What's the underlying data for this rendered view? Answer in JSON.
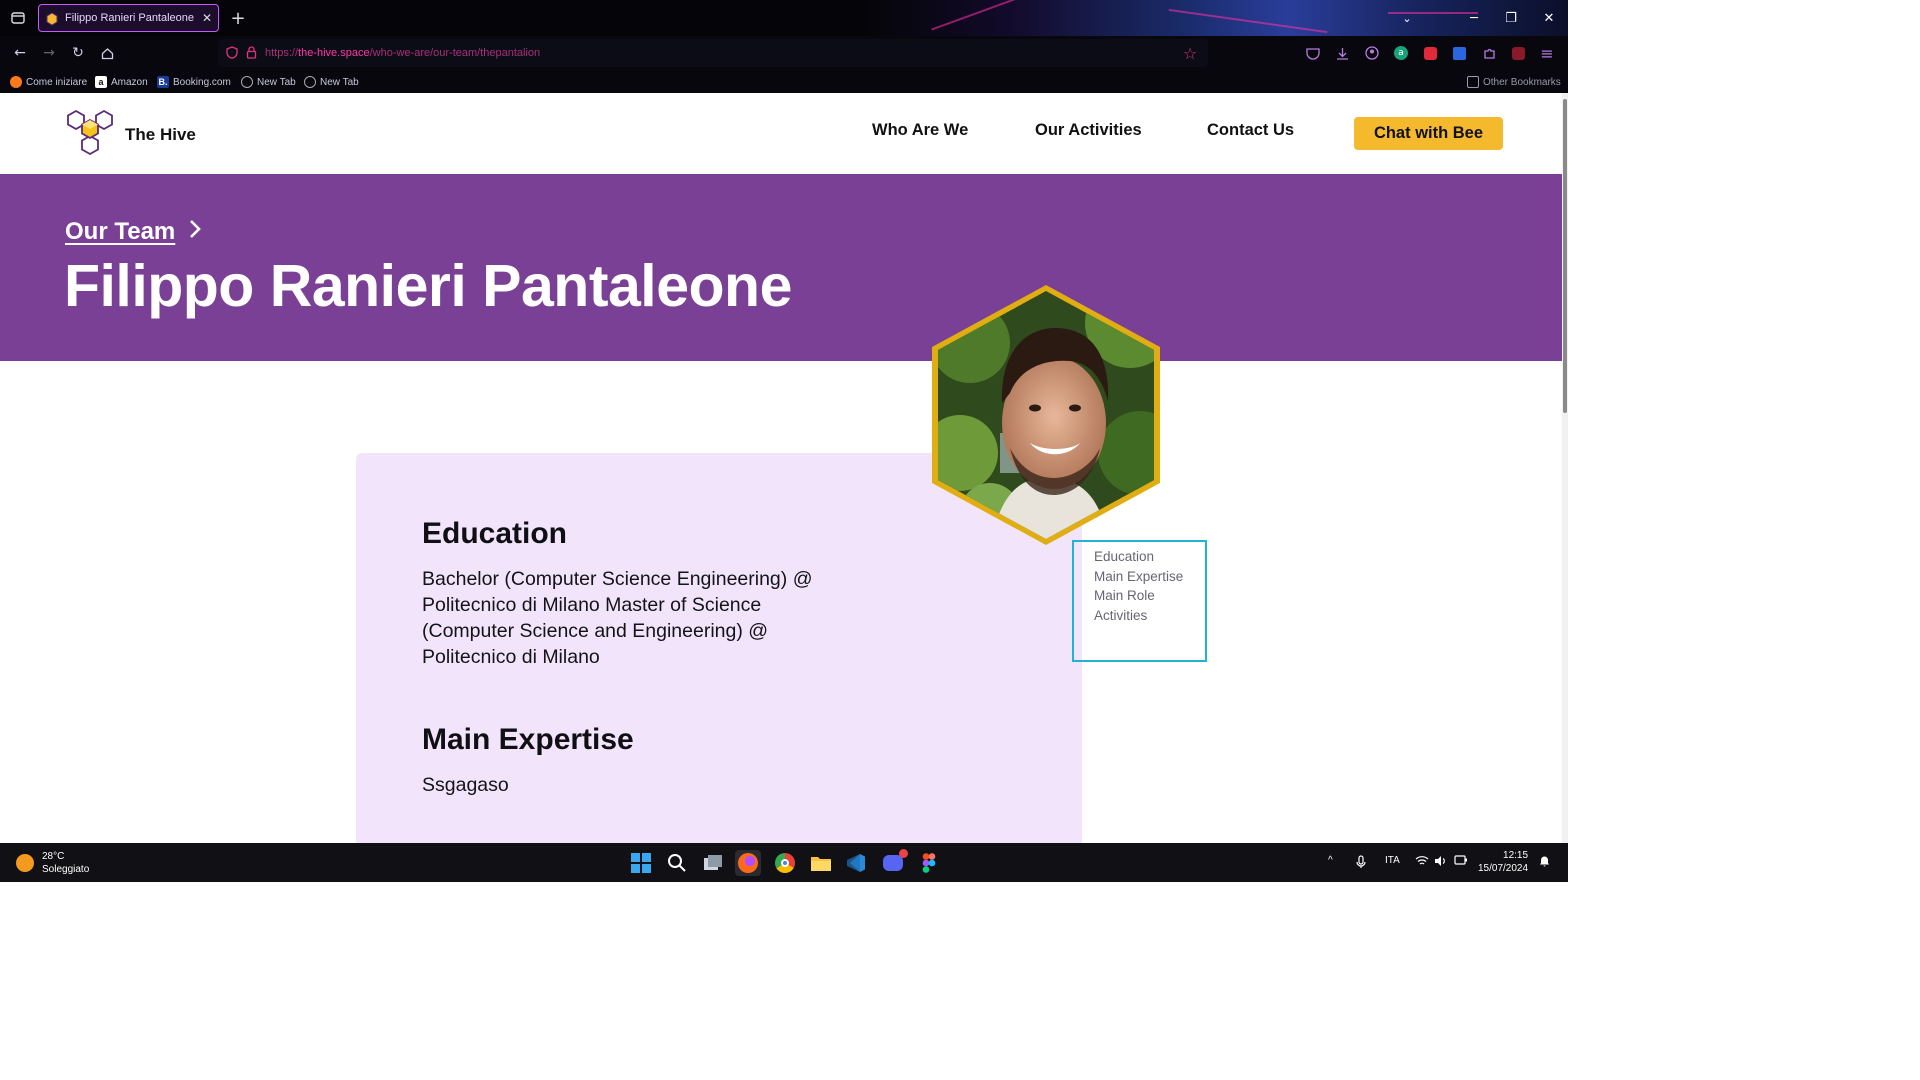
{
  "browser": {
    "tab_title": "Filippo Ranieri Pantaleone | Team",
    "url_prefix": "https://",
    "url_domain": "the-hive.space",
    "url_path": "/who-we-are/our-team/thepantalion",
    "bookmarks": [
      "Come iniziare",
      "Amazon",
      "Booking.com",
      "New Tab",
      "New Tab"
    ],
    "other_bookmarks": "Other Bookmarks",
    "win_controls": {
      "min": "─",
      "max": "❐",
      "close": "✕"
    }
  },
  "site": {
    "name": "The Hive",
    "nav": [
      "Who Are We",
      "Our Activities",
      "Contact Us"
    ],
    "cta": "Chat with Bee",
    "accent_purple": "#7a4095",
    "accent_yellow": "#f5b92e"
  },
  "hero": {
    "breadcrumb": "Our Team",
    "person_name": "Filippo Ranieri Pantaleone"
  },
  "profile": {
    "education_title": "Education",
    "education_body": "Bachelor (Computer Science Engineering) @ Politecnico di Milano Master of Science (Computer Science and Engineering) @ Politecnico di Milano",
    "expertise_title": "Main Expertise",
    "expertise_body": "Ssgagaso"
  },
  "toc": [
    "Education",
    "Main Expertise",
    "Main Role",
    "Activities"
  ],
  "taskbar": {
    "temperature": "28°C",
    "weather": "Soleggiato",
    "lang": "ITA",
    "time": "12:15",
    "date": "15/07/2024"
  }
}
